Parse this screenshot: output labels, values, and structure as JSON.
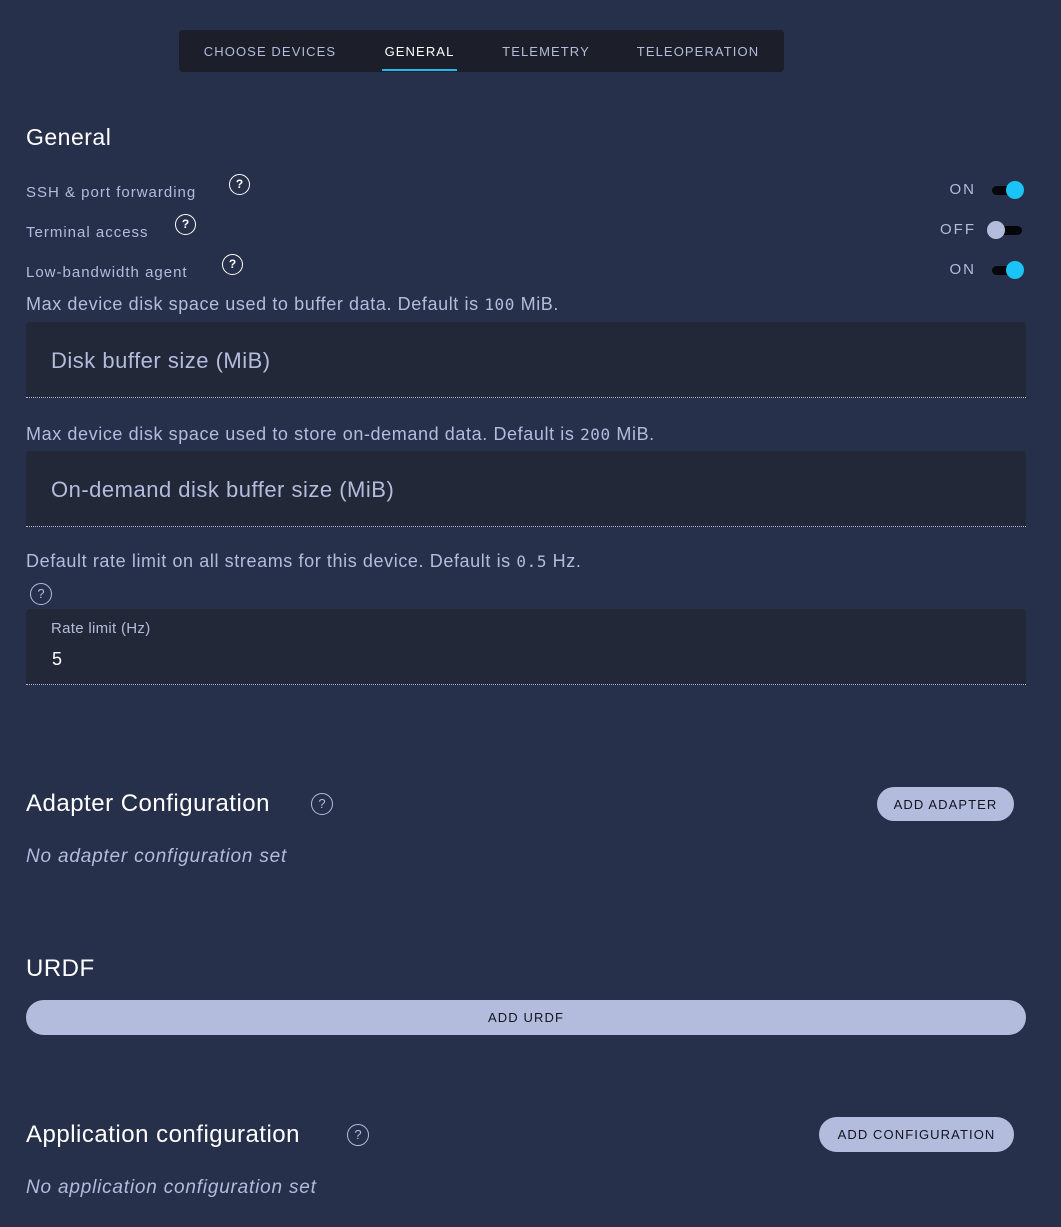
{
  "tabs": [
    {
      "label": "CHOOSE DEVICES",
      "active": false
    },
    {
      "label": "GENERAL",
      "active": true
    },
    {
      "label": "TELEMETRY",
      "active": false
    },
    {
      "label": "TELEOPERATION",
      "active": false
    }
  ],
  "general": {
    "title": "General",
    "settings": [
      {
        "label": "SSH & port forwarding",
        "state": "ON",
        "enabled": true
      },
      {
        "label": "Terminal access",
        "state": "OFF",
        "enabled": false
      },
      {
        "label": "Low-bandwidth agent",
        "state": "ON",
        "enabled": true
      }
    ],
    "disk_buffer": {
      "hint_prefix": "Max device disk space used to buffer data. Default is ",
      "hint_value": "100",
      "hint_suffix": " MiB.",
      "placeholder": "Disk buffer size (MiB)",
      "value": ""
    },
    "on_demand_buffer": {
      "hint_prefix": "Max device disk space used to store on-demand data. Default is ",
      "hint_value": "200",
      "hint_suffix": " MiB.",
      "placeholder": "On-demand disk buffer size (MiB)",
      "value": ""
    },
    "rate_limit": {
      "hint_prefix": "Default rate limit on all streams for this device. Default is ",
      "hint_value": "0.5",
      "hint_suffix": " Hz.",
      "label": "Rate limit (Hz)",
      "value": "5"
    }
  },
  "adapter": {
    "title": "Adapter Configuration",
    "button_label": "ADD ADAPTER",
    "empty_text": "No adapter configuration set"
  },
  "urdf": {
    "title": "URDF",
    "button_label": "ADD URDF"
  },
  "application": {
    "title": "Application configuration",
    "button_label": "ADD CONFIGURATION",
    "empty_text": "No application configuration set"
  },
  "icons": {
    "help": "?"
  },
  "colors": {
    "background": "#27304b",
    "accent": "#1fb9ea",
    "toggle_on": "#1bc4f6",
    "button_bg": "#b3bcdc"
  }
}
